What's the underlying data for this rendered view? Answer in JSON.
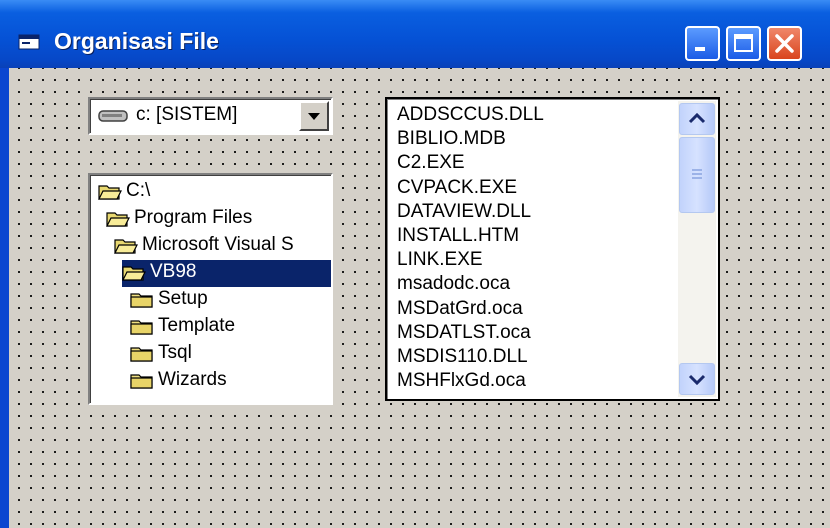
{
  "window": {
    "title": "Organisasi File"
  },
  "drive": {
    "value": "c: [SISTEM]"
  },
  "dirs": [
    {
      "label": "C:\\",
      "indent": 0,
      "open": true,
      "selected": false
    },
    {
      "label": "Program Files",
      "indent": 1,
      "open": true,
      "selected": false
    },
    {
      "label": "Microsoft Visual S",
      "indent": 2,
      "open": true,
      "selected": false
    },
    {
      "label": "VB98",
      "indent": 3,
      "open": true,
      "selected": true
    },
    {
      "label": "Setup",
      "indent": 4,
      "open": false,
      "selected": false
    },
    {
      "label": "Template",
      "indent": 4,
      "open": false,
      "selected": false
    },
    {
      "label": "Tsql",
      "indent": 4,
      "open": false,
      "selected": false
    },
    {
      "label": "Wizards",
      "indent": 4,
      "open": false,
      "selected": false
    }
  ],
  "files": [
    "ADDSCCUS.DLL",
    "BIBLIO.MDB",
    "C2.EXE",
    "CVPACK.EXE",
    "DATAVIEW.DLL",
    "INSTALL.HTM",
    "LINK.EXE",
    "msadodc.oca",
    "MSDatGrd.oca",
    "MSDATLST.oca",
    "MSDIS110.DLL",
    "MSHFlxGd.oca"
  ],
  "colors": {
    "title_bar": "#0552d6",
    "selection": "#0a246a",
    "form_bg": "#d4d0c8"
  },
  "icons": {
    "title": "form-icon",
    "drive": "hard-drive-icon",
    "folder": "folder-icon"
  }
}
